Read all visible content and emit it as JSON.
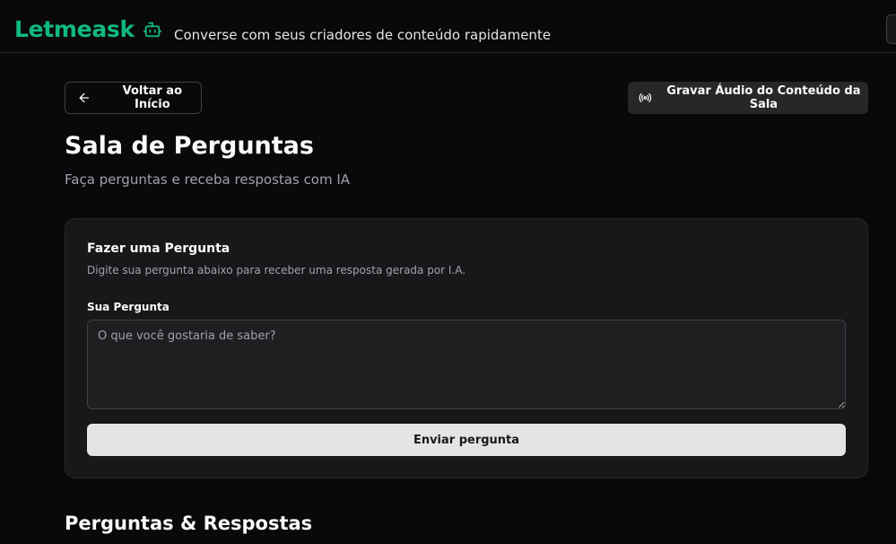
{
  "header": {
    "brand": "Letmeask",
    "tagline": "Converse com seus criadores de conteúdo rapidamente",
    "brand_color": "#10b981"
  },
  "actions": {
    "back_label": "Voltar ao Início",
    "record_label": "Gravar Áudio do Conteúdo da Sala"
  },
  "page": {
    "title": "Sala de Perguntas",
    "subtitle": "Faça perguntas e receba respostas com IA"
  },
  "question_form": {
    "title": "Fazer uma Pergunta",
    "description": "Digite sua pergunta abaixo para receber uma resposta gerada por I.A.",
    "field_label": "Sua Pergunta",
    "placeholder": "O que você gostaria de saber?",
    "value": "",
    "submit_label": "Enviar pergunta"
  },
  "qa_section": {
    "title": "Perguntas & Respostas"
  },
  "icons": {
    "brand": "bot-icon",
    "back": "arrow-left-icon",
    "record": "radio-icon"
  }
}
